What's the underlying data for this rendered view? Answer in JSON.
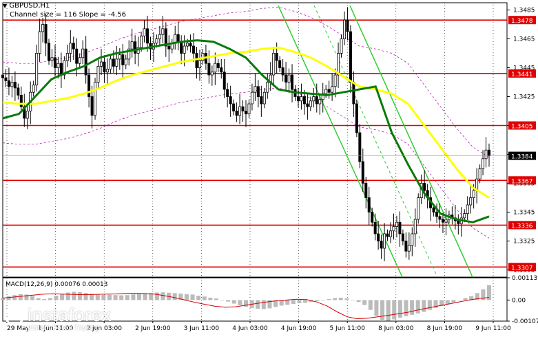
{
  "header": {
    "symbol": "GBPUSD,H1",
    "channel_info": "Channel size = 116 Slope = -4.56",
    "macd_label": "MACD(12,26,9) 0.00076 0.00013"
  },
  "watermark": {
    "brand": "instaforex",
    "tagline": "Instant Forex Trading"
  },
  "chart_data": [
    {
      "type": "candlestick",
      "title": "GBPUSD,H1",
      "subtitle": "Channel size = 116 Slope = -4.56",
      "x_ticks": [
        "29 May",
        "1 Jun 11:00",
        "2 Jun 03:00",
        "2 Jun 19:00",
        "3 Jun 11:00",
        "4 Jun 03:00",
        "4 Jun 19:00",
        "5 Jun 11:00",
        "8 Jun 03:00",
        "8 Jun 19:00",
        "9 Jun 11:00"
      ],
      "y_ticks": [
        1.3485,
        1.3465,
        1.3445,
        1.3425,
        1.3405,
        1.3385,
        1.3365,
        1.3345,
        1.3325,
        1.3305
      ],
      "ylim": [
        1.33,
        1.349
      ],
      "horizontal_levels": [
        1.3478,
        1.3441,
        1.3405,
        1.3367,
        1.3336,
        1.3307
      ],
      "current_price": 1.3384,
      "current_price_label": "1.3384",
      "close_series": [
        1.3438,
        1.3436,
        1.3432,
        1.3435,
        1.3431,
        1.3426,
        1.3418,
        1.341,
        1.3415,
        1.3428,
        1.3433,
        1.3455,
        1.347,
        1.3475,
        1.3462,
        1.345,
        1.3452,
        1.3445,
        1.3448,
        1.344,
        1.345,
        1.3455,
        1.3462,
        1.3458,
        1.3448,
        1.3452,
        1.3458,
        1.344,
        1.3425,
        1.3412,
        1.3435,
        1.3446,
        1.3449,
        1.3442,
        1.3444,
        1.3451,
        1.3446,
        1.3451,
        1.3454,
        1.3447,
        1.3451,
        1.3458,
        1.3463,
        1.3455,
        1.3459,
        1.3467,
        1.3472,
        1.3462,
        1.3458,
        1.3462,
        1.3465,
        1.3468,
        1.3472,
        1.346,
        1.3458,
        1.3462,
        1.3468,
        1.3463,
        1.3455,
        1.346,
        1.3462,
        1.346,
        1.3455,
        1.3445,
        1.345,
        1.3455,
        1.3448,
        1.344,
        1.3442,
        1.3448,
        1.3445,
        1.3442,
        1.343,
        1.3425,
        1.342,
        1.3415,
        1.3412,
        1.3418,
        1.3415,
        1.3413,
        1.342,
        1.3428,
        1.3432,
        1.3425,
        1.342,
        1.3428,
        1.3435,
        1.344,
        1.3455,
        1.345,
        1.3445,
        1.344,
        1.3435,
        1.344,
        1.343,
        1.3425,
        1.3422,
        1.3425,
        1.342,
        1.3418,
        1.3422,
        1.3425,
        1.342,
        1.3423,
        1.3427,
        1.343,
        1.3428,
        1.3432,
        1.344,
        1.3455,
        1.3465,
        1.3478,
        1.347,
        1.3435,
        1.342,
        1.34,
        1.338,
        1.3365,
        1.3355,
        1.3345,
        1.3338,
        1.333,
        1.3325,
        1.332,
        1.333,
        1.3328,
        1.3332,
        1.3335,
        1.3338,
        1.333,
        1.3325,
        1.3318,
        1.3322,
        1.333,
        1.334,
        1.3355,
        1.3365,
        1.336,
        1.3355,
        1.3348,
        1.3345,
        1.3342,
        1.334,
        1.3338,
        1.334,
        1.3343,
        1.3341,
        1.3339,
        1.3337,
        1.3341,
        1.3344,
        1.335,
        1.3355,
        1.336,
        1.3368,
        1.3375,
        1.3382,
        1.3388,
        1.3384
      ],
      "overlays": [
        {
          "name": "MA slow",
          "color": "#ffff00",
          "values": [
            1.3421,
            1.342,
            1.342,
            1.3422,
            1.3424,
            1.3427,
            1.3431,
            1.3436,
            1.344,
            1.3443,
            1.3446,
            1.3449,
            1.3451,
            1.3453,
            1.3455,
            1.3456,
            1.3458,
            1.3459,
            1.3456,
            1.3452,
            1.3446,
            1.3439,
            1.3432,
            1.343,
            1.3427,
            1.342,
            1.3405,
            1.339,
            1.3375,
            1.3362,
            1.3355
          ]
        },
        {
          "name": "MA fast",
          "color": "#0a7a0a",
          "values": [
            1.341,
            1.3413,
            1.3425,
            1.3437,
            1.3442,
            1.3446,
            1.3452,
            1.3455,
            1.3457,
            1.3459,
            1.3461,
            1.3463,
            1.3464,
            1.3463,
            1.3458,
            1.3452,
            1.344,
            1.343,
            1.3428,
            1.3427,
            1.3426,
            1.3428,
            1.343,
            1.3432,
            1.34,
            1.3378,
            1.3358,
            1.3344,
            1.334,
            1.3338,
            1.3342
          ]
        }
      ]
    },
    {
      "type": "bar",
      "title": "MACD(12,26,9) 0.00076 0.00013",
      "y_ticks": [
        "0.00113",
        "0.00",
        "-0.00107"
      ],
      "ylim": [
        -0.00107,
        0.00113
      ],
      "histogram": [
        0.0001,
        0.0002,
        0.00025,
        0.0003,
        0.00028,
        0.0002,
        0.0001,
        5e-05,
        0.0001,
        0.00022,
        0.00032,
        0.00038,
        0.00042,
        0.0004,
        0.00036,
        0.00032,
        0.00028,
        0.00026,
        0.00027,
        0.00025,
        0.00024,
        0.00025,
        0.00028,
        0.00031,
        0.00034,
        0.00036,
        0.00038,
        0.00039,
        0.00037,
        0.00035,
        0.00033,
        0.0003,
        0.00028,
        0.00022,
        0.00018,
        0.00012,
        8e-05,
        0.0,
        -8e-05,
        -0.00018,
        -0.00026,
        -0.00034,
        -0.0004,
        -0.00044,
        -0.00046,
        -0.00042,
        -0.00035,
        -0.00028,
        -0.00024,
        -0.0002,
        -0.00016,
        -0.00014,
        -0.0001,
        -6e-05,
        -2e-05,
        5e-05,
        0.0001,
        0.00012,
        8e-05,
        0.0,
        -0.0001,
        -0.00025,
        -0.0005,
        -0.0008,
        -0.001,
        -0.00105,
        -0.00098,
        -0.0009,
        -0.00082,
        -0.00075,
        -0.00068,
        -0.0006,
        -0.0005,
        -0.0004,
        -0.0003,
        -0.00022,
        -0.00012,
        -2e-05,
        0.0001,
        0.0002,
        0.00035,
        0.00055,
        0.00076
      ],
      "signal": [
        0.0001,
        0.00015,
        0.0002,
        0.00025,
        0.0003,
        0.00032,
        0.0003,
        0.00028,
        0.00027,
        0.00028,
        0.0003,
        0.00031,
        0.00033,
        0.00034,
        0.00033,
        0.0003,
        0.00022,
        0.00012,
        0.0,
        -0.00012,
        -0.00022,
        -0.00032,
        -0.00036,
        -0.00034,
        -0.00026,
        -0.00018,
        -0.0001,
        -4e-05,
        0.0,
        4e-05,
        2e-05,
        -0.0001,
        -0.0003,
        -0.0006,
        -0.00085,
        -0.00095,
        -0.00092,
        -0.00085,
        -0.00078,
        -0.0007,
        -0.00062,
        -0.0005,
        -0.0004,
        -0.0003,
        -0.0002,
        -0.0001,
        0.0,
        8e-05,
        0.00013
      ]
    }
  ],
  "colors": {
    "bull_candle": "#ffffff",
    "bear_candle": "#000000",
    "level_line": "#e00000",
    "channel_line": "#32cd32",
    "envelope_line": "#b000b0",
    "macd_hist": "#bbbbbb",
    "macd_signal": "#d00000",
    "label_bg": "#e00000",
    "label_text": "#ffffff"
  }
}
